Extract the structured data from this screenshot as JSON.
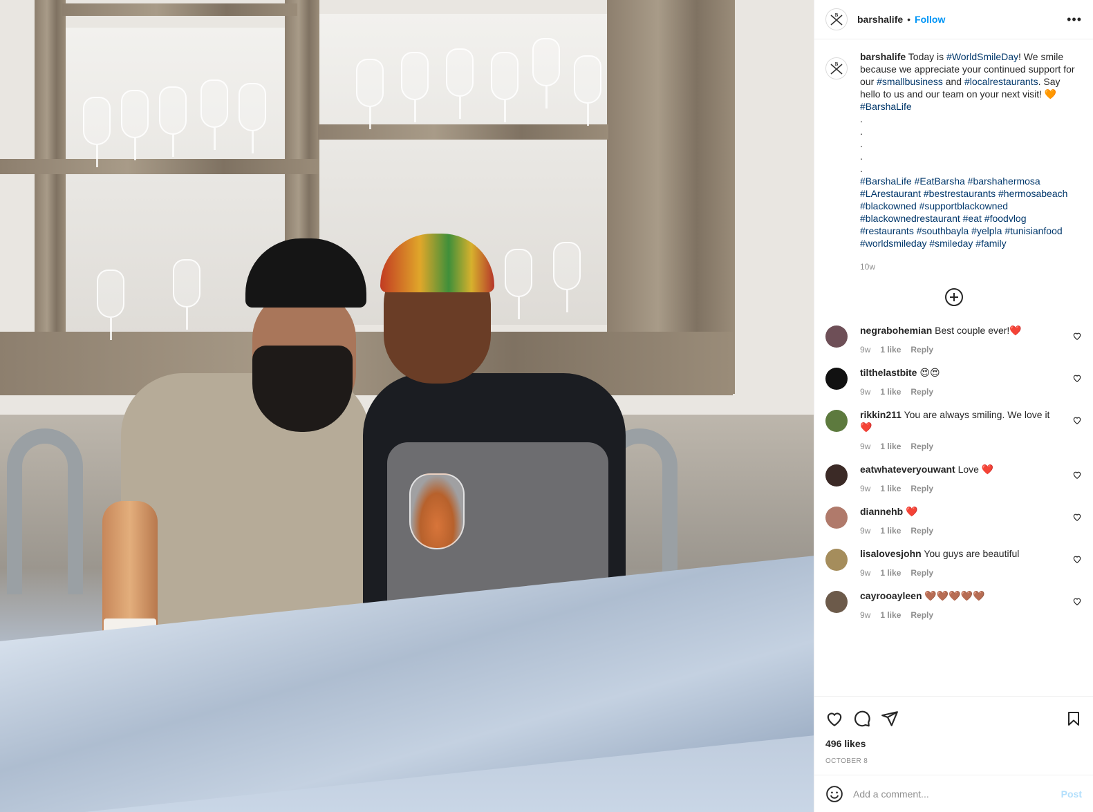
{
  "photo": {
    "alt_hint": ""
  },
  "header": {
    "username": "barshalife",
    "separator": "•",
    "follow_label": "Follow",
    "more_label": "•••"
  },
  "caption": {
    "username": "barshalife",
    "text_1": " Today is ",
    "tag_1": "#WorldSmileDay",
    "text_2": "! We smile because we appreciate your continued support for our ",
    "tag_2": "#smallbusiness",
    "text_3": " and ",
    "tag_3": "#localrestaurants",
    "text_4": ". Say hello to us and our team on your next visit! 🧡",
    "tag_4": "#BarshaLife",
    "dots": [
      ".",
      ".",
      ".",
      ".",
      "."
    ],
    "hashtags": "#BarshaLife #EatBarsha #barshahermosa #LArestaurant #bestrestaurants #hermosabeach #blackowned #supportblackowned #blackownedrestaurant #eat #foodvlog #restaurants #southbayla #yelpla #tunisianfood #worldsmileday #smileday #family",
    "time": "10w"
  },
  "comments": [
    {
      "username": "negrabohemian",
      "text": " Best couple ever!❤️",
      "time": "9w",
      "likes": "1 like",
      "reply": "Reply",
      "avatar_color": "#6e4f57"
    },
    {
      "username": "tilthelastbite",
      "text": " 😍😍",
      "time": "9w",
      "likes": "1 like",
      "reply": "Reply",
      "avatar_color": "#111111"
    },
    {
      "username": "rikkin211",
      "text": " You are always smiling. We love it❤️",
      "time": "9w",
      "likes": "1 like",
      "reply": "Reply",
      "avatar_color": "#5d7a3e"
    },
    {
      "username": "eatwhateveryouwant",
      "text": " Love ❤️",
      "time": "9w",
      "likes": "1 like",
      "reply": "Reply",
      "avatar_color": "#3b2a26"
    },
    {
      "username": "diannehb",
      "text": " ❤️",
      "time": "9w",
      "likes": "1 like",
      "reply": "Reply",
      "avatar_color": "#b07a6b"
    },
    {
      "username": "lisalovesjohn",
      "text": " You guys are beautiful",
      "time": "9w",
      "likes": "1 like",
      "reply": "Reply",
      "avatar_color": "#a58d5c"
    },
    {
      "username": "cayrooayleen",
      "text": " 🤎🤎🤎🤎🤎",
      "time": "9w",
      "likes": "1 like",
      "reply": "Reply",
      "avatar_color": "#6c5a4a"
    }
  ],
  "actions": {
    "likes": "496 likes",
    "date": "October 8"
  },
  "add_comment": {
    "placeholder": "Add a comment...",
    "post_label": "Post"
  },
  "colors": {
    "link": "#0095f6",
    "tag": "#00376b",
    "muted": "#8e8e8e",
    "text": "#262626"
  }
}
